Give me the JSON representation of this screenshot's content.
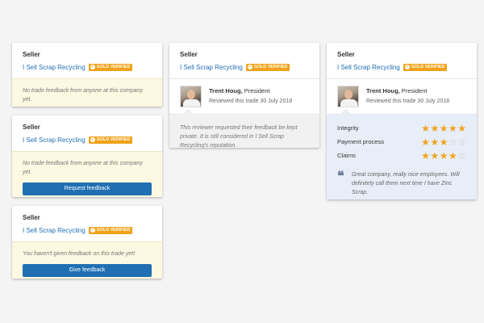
{
  "common": {
    "seller_label": "Seller",
    "seller_name": "I Sell Scrap Recycling",
    "badge_text": "GOLD VERIFIED"
  },
  "card1": {
    "message": "No trade feedback from anyone at this company yet."
  },
  "card2": {
    "message": "No trade feedback from anyone at this company yet.",
    "button": "Request feedback"
  },
  "card3": {
    "message": "You haven't given feedback on this trade yet!",
    "button": "Give feedback"
  },
  "reviewer": {
    "name": "Trent Houg,",
    "title": "President",
    "date": "Reviewed this trade 30 July 2018"
  },
  "card4": {
    "private_note": "This reviewer requested their feedback be kept private. It is still considered in I Sell Scrap Recycling's reputation."
  },
  "card5": {
    "ratings": [
      {
        "label": "Integrity",
        "stars": 5
      },
      {
        "label": "Payment process",
        "stars": 3
      },
      {
        "label": "Claims",
        "stars": 4
      }
    ],
    "quote": "Great company, really nice employees. Will definitely call them next time I have Zinc Scrap."
  },
  "colors": {
    "accent": "#1f6fb2",
    "gold": "#f0a31a",
    "yellow_bg": "#fdf8e1",
    "blue_bg": "#e8eef8"
  },
  "icons": [
    "check-icon",
    "star-icon",
    "quote-icon",
    "avatar"
  ]
}
